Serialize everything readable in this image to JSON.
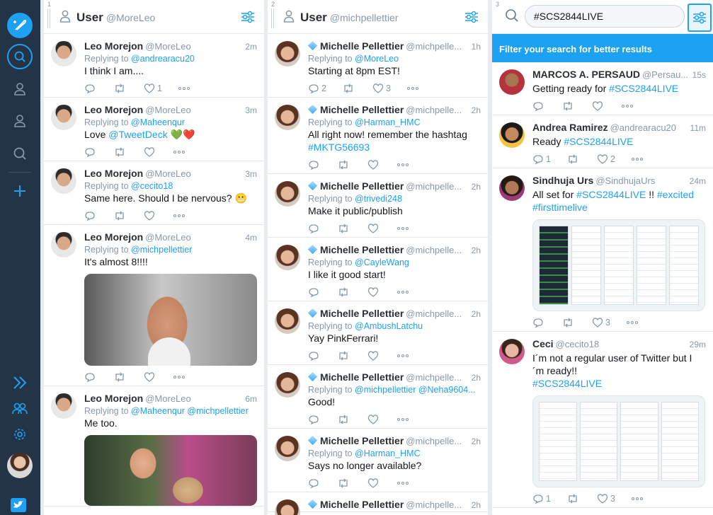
{
  "colors": {
    "accent": "#1da1f2",
    "sidebar": "#243447"
  },
  "sidebar": {
    "items": [
      "compose-icon",
      "search-icon",
      "user-icon",
      "user-icon",
      "search-icon",
      "add-column-icon",
      "expand-icon",
      "team-icon",
      "settings-icon",
      "avatar",
      "twitter-bird-icon"
    ]
  },
  "columns": [
    {
      "number": "1",
      "title": "User",
      "handle": "@MoreLeo",
      "tweets": [
        {
          "name": "Leo Morejon",
          "handle": "@MoreLeo",
          "time": "2m",
          "reply_label": "Replying to",
          "reply_to": "@andrearacu20",
          "text": "I think I am....",
          "likes": "1"
        },
        {
          "name": "Leo Morejon",
          "handle": "@MoreLeo",
          "time": "3m",
          "reply_label": "Replying to",
          "reply_to": "@Maheenqur",
          "text_pre": "Love ",
          "link": "@TweetDeck",
          "emoji": "💚❤️"
        },
        {
          "name": "Leo Morejon",
          "handle": "@MoreLeo",
          "time": "3m",
          "reply_label": "Replying to",
          "reply_to": "@cecito18",
          "text": "Same here. Should I be nervous? 😬"
        },
        {
          "name": "Leo Morejon",
          "handle": "@MoreLeo",
          "time": "4m",
          "reply_label": "Replying to",
          "reply_to": "@michpellettier",
          "text": "It's almost 8!!!!"
        },
        {
          "name": "Leo Morejon",
          "handle": "@MoreLeo",
          "time": "6m",
          "reply_label": "Replying to",
          "reply_to": "@Maheenqur @michpellettier",
          "text": "Me too."
        }
      ]
    },
    {
      "number": "2",
      "title": "User",
      "handle": "@michpellettier",
      "tweets": [
        {
          "name": "Michelle Pellettier",
          "handle": "@michpelle...",
          "time": "1h",
          "reply_label": "Replying to",
          "reply_to": "@MoreLeo",
          "text": "Starting at 8pm EST!",
          "replies": "2",
          "likes": "3"
        },
        {
          "name": "Michelle Pellettier",
          "handle": "@michpelle...",
          "time": "2h",
          "reply_label": "Replying to",
          "reply_to": "@Harman_HMC",
          "text": "All right now! remember the hashtag",
          "tag": "#MKTG56693"
        },
        {
          "name": "Michelle Pellettier",
          "handle": "@michpelle...",
          "time": "2h",
          "reply_label": "Replying to",
          "reply_to": "@trivedi248",
          "text": "Make it public/publish"
        },
        {
          "name": "Michelle Pellettier",
          "handle": "@michpelle...",
          "time": "2h",
          "reply_label": "Replying to",
          "reply_to": "@CayleWang",
          "text": "I like it good start!"
        },
        {
          "name": "Michelle Pellettier",
          "handle": "@michpelle...",
          "time": "2h",
          "reply_label": "Replying to",
          "reply_to": "@AmbushLatchu",
          "text": "Yay PinkFerrari!"
        },
        {
          "name": "Michelle Pellettier",
          "handle": "@michpelle...",
          "time": "2h",
          "reply_label": "Replying to",
          "reply_to": "@michpellettier @Neha9604...",
          "text": "Good!"
        },
        {
          "name": "Michelle Pellettier",
          "handle": "@michpelle...",
          "time": "2h",
          "reply_label": "Replying to",
          "reply_to": "@Harman_HMC",
          "text": "Says no longer available?"
        },
        {
          "name": "Michelle Pellettier",
          "handle": "@michpelle...",
          "time": "2h"
        }
      ]
    },
    {
      "number": "3",
      "search_value": "#SCS2844LIVE",
      "banner": "Filter your search for better results",
      "tweets": [
        {
          "name": "MARCOS A. PERSAUD",
          "handle": "@Persau...",
          "time": "15s",
          "text": "Getting ready for ",
          "tag": "#SCS2844LIVE"
        },
        {
          "name": "Andrea Ramirez",
          "handle": "@andrearacu20",
          "time": "11m",
          "text": "Ready ",
          "tag": "#SCS2844LIVE",
          "replies": "1",
          "likes": "2"
        },
        {
          "name": "Sindhuja Urs",
          "handle": "@SindhujaUrs",
          "time": "24m",
          "text": "All set for ",
          "tag": "#SCS2844LIVE",
          "text2": " !! ",
          "tag2": "#excited",
          "tag3": "#firsttimelive",
          "likes": "3"
        },
        {
          "name": "Ceci",
          "handle": "@cecito18",
          "time": "29m",
          "text": "I´m not a regular user of Twitter but I ´m ready!!",
          "tag": "#SCS2844LIVE",
          "replies": "1",
          "likes": "3"
        }
      ]
    }
  ]
}
